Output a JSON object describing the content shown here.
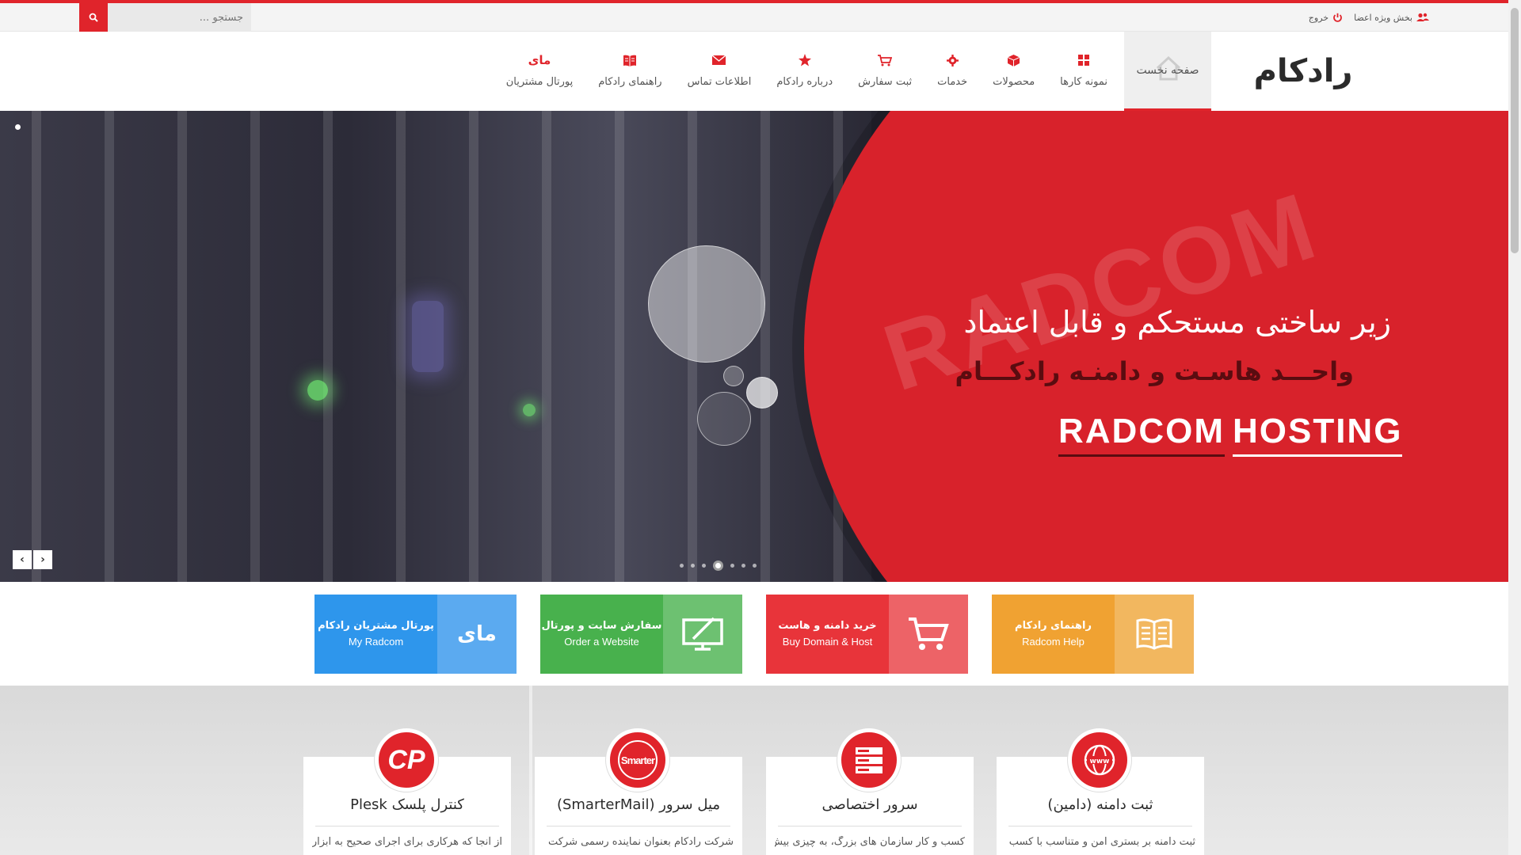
{
  "topbar": {
    "search_placeholder": "جستجو ...",
    "search_icon": "search-icon",
    "members_label": "بخش ویژه اعضا",
    "logout_label": "خروج"
  },
  "header": {
    "logo_text": "رادکام",
    "home_label": "صفحه نخست",
    "nav": [
      {
        "label": "نمونه کارها",
        "icon": "grid-icon"
      },
      {
        "label": "محصولات",
        "icon": "box-icon"
      },
      {
        "label": "خدمات",
        "icon": "gear-icon"
      },
      {
        "label": "ثبت سفارش",
        "icon": "cart-icon"
      },
      {
        "label": "درباره رادکام",
        "icon": "star-icon"
      },
      {
        "label": "اطلاعات تماس",
        "icon": "envelope-icon"
      },
      {
        "label": "راهنمای رادکام",
        "icon": "book-icon"
      },
      {
        "label": "پورتال مشتریان",
        "icon_text": "مای"
      }
    ]
  },
  "hero": {
    "watermark": "RADCOM",
    "title": "زیر ساختی مستحکم و قابل اعتماد",
    "subtitle": "واحـــد هاسـت و دامنـه رادکـــام",
    "brand_part1": "RADCOM",
    "brand_part2": "HOSTING",
    "prev_arrow": "‹",
    "next_arrow": "›",
    "slide_count": 7,
    "active_slide": 4
  },
  "tiles": [
    {
      "fa": "راهنمای رادکام",
      "en": "Radcom Help",
      "color": "#f0a232",
      "icon_color": "#f2b75f",
      "icon": "book-icon"
    },
    {
      "fa": "خرید دامنه و هاست",
      "en": "Buy Domain & Host",
      "color": "#e8343a",
      "icon_color": "#ed6367",
      "icon": "cart-icon"
    },
    {
      "fa": "سفارش سایت و پورتال",
      "en": "Order a Website",
      "color": "#48b14d",
      "icon_color": "#6dc171",
      "icon": "monitor-icon"
    },
    {
      "fa": "پورتال مشتریان رادکام",
      "en": "My Radcom",
      "color": "#2e96ec",
      "icon_color": "#5baaf0",
      "icon_text": "مای"
    }
  ],
  "services": [
    {
      "title": "ثبت دامنه (دامین)",
      "desc": "ثبت دامنه بر بستری امن و متناسب با کسب",
      "icon": "globe-www-icon"
    },
    {
      "title": "سرور اختصاصی",
      "desc": "کسب و کار سازمان های بزرگ، به چیزی بیش",
      "icon": "server-icon"
    },
    {
      "title": "میل سرور (SmarterMail)",
      "desc": "شرکت رادکام بعنوان نماینده رسمی شرکت",
      "icon_text": "Smarter"
    },
    {
      "title": "کنترل پلسک Plesk",
      "desc": "از آنجا که هرکاری برای اجرای صحیح به ابزار",
      "icon_text": "CP"
    }
  ],
  "colors": {
    "accent": "#e0242b",
    "hero_red": "#d8222b"
  }
}
